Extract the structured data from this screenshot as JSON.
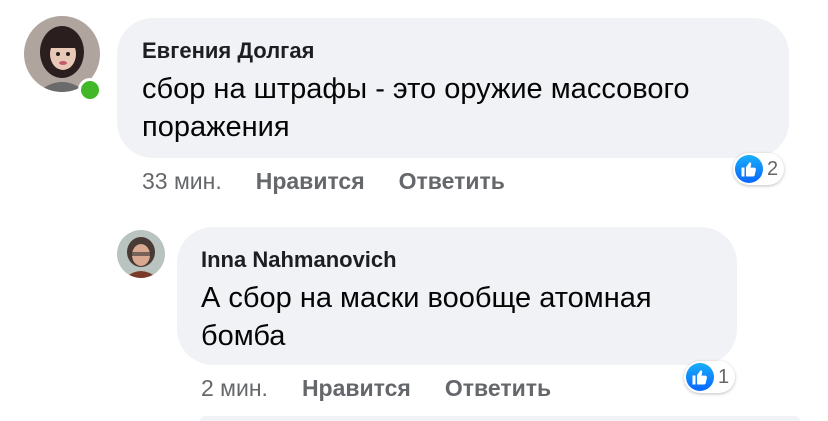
{
  "comments": [
    {
      "author": "Евгения Долгая",
      "text": "сбор на штрафы - это оружие массового поражения",
      "time": "33 мин.",
      "like_label": "Нравится",
      "reply_label": "Ответить",
      "reaction_icon": "like-icon",
      "reaction_count": "2",
      "online": true
    },
    {
      "author": "Inna Nahmanovich",
      "text": "А сбор на маски вообще атомная бомба",
      "time": "2 мин.",
      "like_label": "Нравится",
      "reply_label": "Ответить",
      "reaction_icon": "like-icon",
      "reaction_count": "1",
      "online": false
    }
  ],
  "colors": {
    "bubble": "#f0f2f5",
    "online": "#42b72a",
    "like": "#1877f2",
    "secondary_text": "#65676b"
  }
}
